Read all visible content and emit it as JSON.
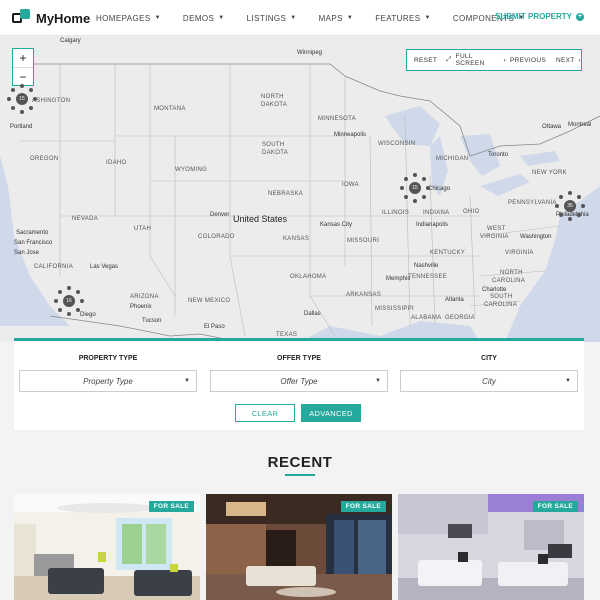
{
  "header": {
    "logo_text": "MyHome",
    "nav": [
      {
        "label": "HOMEPAGES"
      },
      {
        "label": "DEMOS"
      },
      {
        "label": "LISTINGS"
      },
      {
        "label": "MAPS"
      },
      {
        "label": "FEATURES"
      },
      {
        "label": "COMPONENTS"
      }
    ],
    "submit_label": "SUBMIT PROPERTY"
  },
  "map": {
    "zoom_in": "+",
    "zoom_out": "−",
    "controls": {
      "reset": "RESET",
      "fullscreen": "FULL SCREEN",
      "previous": "PREVIOUS",
      "next": "NEXT"
    },
    "country": "United States",
    "states": {
      "washington": "ASHINGTON",
      "montana": "MONTANA",
      "north_dakota_1": "NORTH",
      "north_dakota_2": "DAKOTA",
      "minnesota": "MINNESOTA",
      "wisconsin": "WISCONSIN",
      "michigan": "MICHIGAN",
      "south_dakota_1": "SOUTH",
      "south_dakota_2": "DAKOTA",
      "oregon": "OREGON",
      "idaho": "IDAHO",
      "wyoming": "WYOMING",
      "nebraska": "NEBRASKA",
      "iowa": "IOWA",
      "illinois": "ILLINOIS",
      "ohio": "OHIO",
      "pennsylvania": "PENNSYLVANIA",
      "new_york": "NEW YORK",
      "nevada": "NEVADA",
      "utah": "UTAH",
      "colorado": "COLORADO",
      "kansas": "KANSAS",
      "missouri": "MISSOURI",
      "indiana": "INDIANA",
      "west_virginia_1": "WEST",
      "west_virginia_2": "VIRGINIA",
      "virginia": "VIRGINIA",
      "kentucky": "KENTUCKY",
      "california": "CALIFORNIA",
      "oklahoma": "OKLAHOMA",
      "arkansas": "ARKANSAS",
      "tennessee": "TENNESSEE",
      "north_carolina_1": "NORTH",
      "north_carolina_2": "CAROLINA",
      "south_carolina_1": "SOUTH",
      "south_carolina_2": "CAROLINA",
      "arizona": "ARIZONA",
      "new_mexico": "NEW MEXICO",
      "mississippi": "MISSISSIPPI",
      "alabama": "ALABAMA",
      "georgia": "GEORGIA",
      "texas": "TEXAS"
    },
    "cities": {
      "calgary": "Calgary",
      "winnipeg": "Winnipeg",
      "portland": "Portland",
      "minneapolis": "Minneapolis",
      "ottawa": "Ottawa",
      "montreal": "Montreal",
      "toronto": "Toronto",
      "chicago": "Chicago",
      "denver": "Denver",
      "kansas_city": "Kansas City",
      "indianapolis": "Indianapolis",
      "philadelphia": "Philadelphia",
      "washington_dc": "Washington",
      "sacramento": "Sacramento",
      "san_francisco": "San Francisco",
      "san_jose": "San Jose",
      "las_vegas": "Las Vegas",
      "nashville": "Nashville",
      "charlotte": "Charlotte",
      "atlanta": "Atlanta",
      "dallas": "Dallas",
      "el_paso": "El Paso",
      "tucson": "Tucson",
      "phoenix": "Phoenix",
      "diego": "Diego",
      "memphis": "Memphis"
    },
    "clusters": [
      "15",
      "15",
      "35",
      "16"
    ]
  },
  "search": {
    "property_type_label": "PROPERTY TYPE",
    "property_type_value": "Property Type",
    "offer_type_label": "OFFER TYPE",
    "offer_type_value": "Offer Type",
    "city_label": "CITY",
    "city_value": "City",
    "clear_label": "CLEAR",
    "advanced_label": "ADVANCED"
  },
  "recent": {
    "title": "RECENT",
    "cards": [
      {
        "badge": "FOR SALE"
      },
      {
        "badge": "FOR SALE"
      },
      {
        "badge": "FOR SALE"
      }
    ]
  },
  "colors": {
    "accent": "#25a99c",
    "map_bg": "#ececec",
    "water": "#cfd9ea"
  }
}
